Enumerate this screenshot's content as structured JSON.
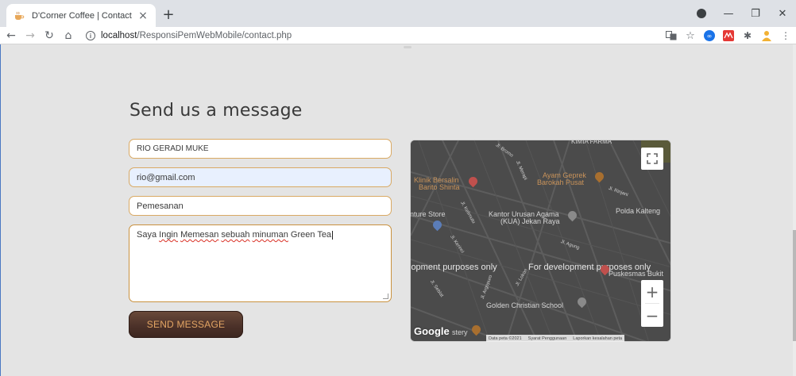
{
  "browser": {
    "tab_title": "D'Corner Coffee | Contact",
    "tab_close": "×",
    "new_tab": "+",
    "url_host": "localhost",
    "url_path": "/ResponsiPemWebMobile/contact.php"
  },
  "page": {
    "heading": "Send us a message",
    "form": {
      "name_value": "RIO GERADI MUKE",
      "email_value": "rio@gmail.com",
      "subject_value": "Pemesanan",
      "message_words": [
        "Saya ",
        "Ingin",
        " ",
        "Memesan",
        " ",
        "sebuah",
        " ",
        "minuman",
        " Green Tea"
      ],
      "submit_label": "SEND MESSAGE"
    }
  },
  "map": {
    "labels": {
      "kimia_farma": "KIMIA FARMA",
      "klinik_1": "Klinik Bersalin",
      "klinik_2": "Barito Shinta",
      "ayam_1": "Ayam Geprek",
      "ayam_2": "Barokah Pusat",
      "polda": "Polda Kalteng",
      "nture": "nture Store",
      "kua_1": "Kantor Urusan Agama",
      "kua_2": "(KUA) Jekan Raya",
      "dev_left": "lopment purposes only",
      "dev_right": "For development purposes only",
      "puskesmas": "Puskesmas Bukit",
      "golden": "Golden Christian School",
      "stery": "stery",
      "st_bromo": "Jl. Bromo",
      "st_merapi": "Jl. Merapi",
      "st_rinjani": "Jl. Rinjani",
      "st_kelimutu": "Jl. Kelimutu",
      "st_kerinci": "Jl. Kerinci",
      "st_agung": "Jl. Agung",
      "st_seblat": "Jl. Seblat",
      "st_argopuro": "Jl. Argopuro",
      "st_lokon": "Jl. Lokon"
    },
    "google": "Google",
    "attribution": {
      "data": "Data peta ©2021",
      "terms": "Syarat Penggunaan",
      "report": "Laporkan kesalahan peta"
    },
    "zoom_in": "+",
    "zoom_out": "−"
  },
  "colors": {
    "field_border": "#d9a963",
    "button_text": "#e2a463",
    "button_bg": "#4a3028",
    "map_bg": "#4b4b4b",
    "page_bg": "#e4e4e4"
  }
}
